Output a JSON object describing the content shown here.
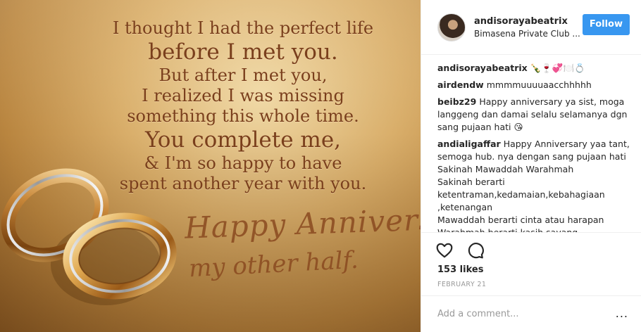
{
  "photo": {
    "quote_lines": [
      "I thought I had the perfect life",
      "before I met you.",
      "But after I met you,",
      "I realized I was missing",
      "something this whole time.",
      "You complete me,",
      "& I'm so happy to have",
      "spent another year with you."
    ],
    "script_line_1": "Happy Anniversary,",
    "script_line_2": "my other half."
  },
  "header": {
    "username": "andisorayabeatrix",
    "location": "Bimasena Private Club ...",
    "follow_label": "Follow"
  },
  "comments": [
    {
      "user": "andisorayabeatrix",
      "text": "🍾🍷💞🍽️💍"
    },
    {
      "user": "airdendw",
      "text": "mmmmuuuuaacchhhhh"
    },
    {
      "user": "beibz29",
      "text": "Happy anniversary ya sist, moga langgeng dan damai selalu selamanya dgn sang pujaan hati 😘"
    },
    {
      "user": "andialigaffar",
      "text": "Happy Anniversary yaa tant, semoga hub. nya dengan sang pujaan hati\nSakinah Mawaddah Warahmah\nSakinah berarti\nketentraman,kedamaian,kebahagiaan\n,ketenangan\nMawaddah berarti cinta atau harapan\nWarahmah berarti kasih sayang"
    }
  ],
  "actions": {
    "like_icon": "heart-icon",
    "comment_icon": "comment-icon"
  },
  "likes": "153 likes",
  "date": "FEBRUARY 21",
  "add_comment": {
    "placeholder": "Add a comment...",
    "more": "..."
  },
  "colors": {
    "follow_bg": "#3897f0",
    "quote_text": "#7a3f1c"
  }
}
